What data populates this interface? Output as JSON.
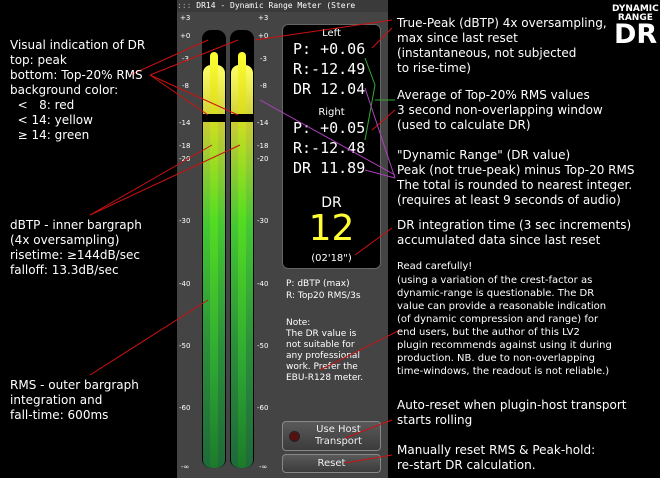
{
  "plugin": {
    "title": "DR14 - Dynamic Range Meter (Stere",
    "left_label": "Left",
    "left_peak": "P: +0.06",
    "left_rms": "R:-12.49",
    "left_dr": "DR 12.04",
    "right_label": "Right",
    "right_peak": "P: +0.05",
    "right_rms": "R:-12.48",
    "right_dr": "DR 11.89",
    "dr_label": "DR",
    "dr_value": "12",
    "dr_time": "(02'18\")",
    "legend_line1": "P: dBTP (max)",
    "legend_line2": "R: Top20 RMS/3s",
    "note_title": "Note:",
    "note_body": "The DR value is\nnot suitable for\nany professional\nwork. Prefer the\nEBU-R128 meter.",
    "use_host_line1": "Use Host",
    "use_host_line2": "Transport",
    "reset_label": "Reset",
    "scale_left": [
      "+3",
      "+0",
      "-3",
      "-8",
      "-14",
      "-18",
      "-20",
      "-30",
      "-40",
      "-50",
      "-60",
      "-∞"
    ],
    "scale_right": [
      "+3",
      "+0",
      "-3",
      "-8",
      "-14",
      "-18",
      "-20",
      "-30",
      "-40",
      "-50",
      "-60",
      "-∞"
    ],
    "meters": {
      "outer_level": 0.92,
      "inner_level": 0.95
    }
  },
  "annotations": {
    "visual": "Visual indication of DR\ntop: peak\nbottom: Top-20% RMS\nbackground color:\n  <   8: red\n  < 14: yellow\n  ≥ 14: green",
    "dbtp": "dBTP - inner bargraph\n(4x oversampling)\nrisetime: ≥144dB/sec\nfalloff: 13.3dB/sec",
    "rms": "RMS - outer bargraph\nintegration and\nfall-time: 600ms",
    "truepeak": "True-Peak (dBTP) 4x oversampling,\nmax since last reset\n(instantaneous, not subjected\nto rise-time)",
    "average": "Average of Top-20% RMS values\n3 second non-overlapping window\n(used to calculate DR)",
    "dynrange": "\"Dynamic Range\" (DR value)\nPeak (not true-peak) minus Top-20 RMS\nThe total is rounded to nearest integer.\n(requires at least 9 seconds of audio)",
    "integration": "DR integration time (3 sec increments)\naccumulated data since last reset",
    "read_title": "Read carefully!",
    "read_body": "(using a variation of the crest-factor as\ndynamic-range is questionable. The DR\nvalue can provide a reasonable indication\n(of dynamic compression and range) for\nend users, but the author of this LV2\nplugin recommends against using it during\nproduction. NB. due to non-overlapping\ntime-windows, the readout is not reliable.)",
    "autoreset": "Auto-reset when plugin-host transport\nstarts rolling",
    "manualreset": "Manually reset RMS & Peak-hold:\nre-start DR calculation."
  },
  "logo": {
    "top": "DYNAMIC\nRANGE",
    "main": "DR"
  },
  "colors": {
    "annotation_line_red": "#cc1111",
    "annotation_line_green": "#33aa33",
    "annotation_line_purple": "#b040c0",
    "dr_value": "#ffff33"
  }
}
